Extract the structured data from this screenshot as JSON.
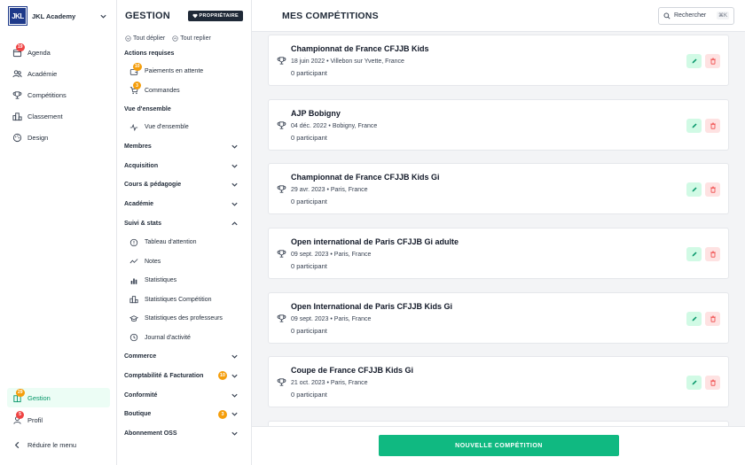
{
  "brand": {
    "logo_text": "JKL",
    "name": "JKL Academy"
  },
  "nav": {
    "items": [
      {
        "label": "Agenda",
        "icon": "calendar-icon",
        "badge": "19"
      },
      {
        "label": "Académie",
        "icon": "users-icon"
      },
      {
        "label": "Compétitions",
        "icon": "trophy-icon"
      },
      {
        "label": "Classement",
        "icon": "podium-icon"
      },
      {
        "label": "Design",
        "icon": "palette-icon"
      }
    ],
    "bottom": [
      {
        "label": "Gestion",
        "icon": "building-icon",
        "badge": "29"
      },
      {
        "label": "Profil",
        "icon": "user-icon",
        "badge": "5"
      }
    ],
    "collapse_label": "Réduire le menu"
  },
  "panel": {
    "title": "GESTION",
    "owner_badge": "PROPRIÉTAIRE",
    "expand_all": "Tout déplier",
    "collapse_all": "Tout replier",
    "required_actions": {
      "title": "Actions requises",
      "items": [
        {
          "label": "Paiements en attente",
          "badge": "10"
        },
        {
          "label": "Commandes",
          "badge": "3"
        }
      ]
    },
    "overview": {
      "title": "Vue d'ensemble",
      "item": "Vue d'ensemble"
    },
    "groups_top": [
      "Membres",
      "Acquisition",
      "Cours & pédagogie",
      "Académie"
    ],
    "stats": {
      "title": "Suivi & stats",
      "items": [
        "Tableau d'attention",
        "Notes",
        "Statistiques",
        "Statistiques Compétition",
        "Statistiques des professeurs",
        "Journal d'activité"
      ]
    },
    "groups_bottom": [
      {
        "label": "Commerce"
      },
      {
        "label": "Comptabilité & Facturation",
        "badge": "10"
      },
      {
        "label": "Conformité"
      },
      {
        "label": "Boutique",
        "badge": "3"
      },
      {
        "label": "Abonnement OSS"
      }
    ]
  },
  "main": {
    "title": "MES COMPÉTITIONS",
    "search": {
      "label": "Rechercher",
      "shortcut": "⌘K"
    },
    "competitions": [
      {
        "name": "Championnat de France CFJJB Kids",
        "date": "18 juin 2022",
        "location": "Villebon sur Yvette, France",
        "participants": "0 participant"
      },
      {
        "name": "AJP Bobigny",
        "date": "04 déc. 2022",
        "location": "Bobigny, France",
        "participants": "0 participant"
      },
      {
        "name": "Championnat de France CFJJB Kids Gi",
        "date": "29 avr. 2023",
        "location": "Paris, France",
        "participants": "0 participant"
      },
      {
        "name": "Open international de Paris CFJJB Gi adulte",
        "date": "09 sept. 2023",
        "location": "Paris, France",
        "participants": "0 participant"
      },
      {
        "name": "Open International de Paris CFJJB Kids Gi",
        "date": "09 sept. 2023",
        "location": "Paris, France",
        "participants": "0 participant"
      },
      {
        "name": "Coupe de France CFJJB Kids Gi",
        "date": "21 oct. 2023",
        "location": "Paris, France",
        "participants": "0 participant"
      }
    ],
    "new_button": "NOUVELLE COMPÉTITION"
  },
  "colors": {
    "accent": "#10b981",
    "danger": "#ef4444",
    "badge_orange": "#f59e0b",
    "brand": "#1e3a8a"
  }
}
